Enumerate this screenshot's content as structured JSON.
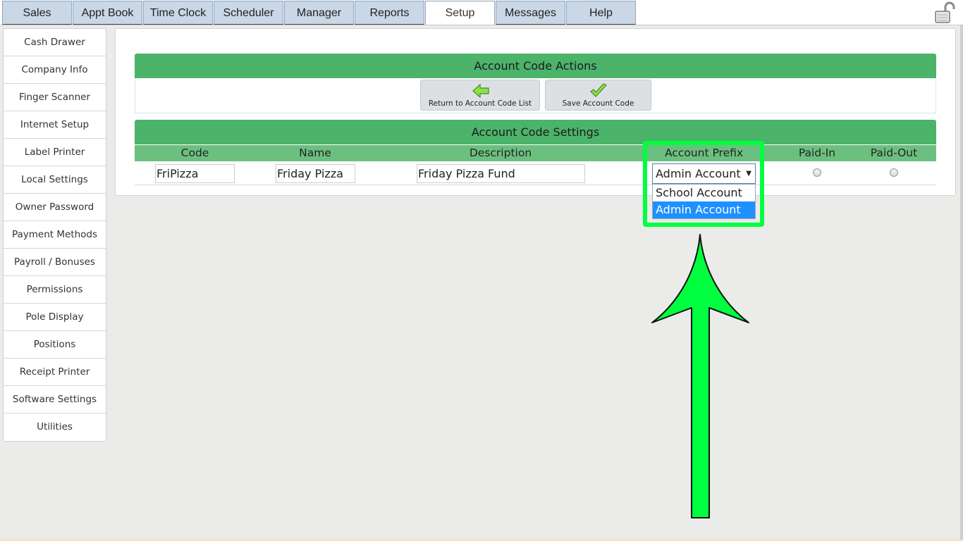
{
  "top_tabs": [
    {
      "label": "Sales"
    },
    {
      "label": "Appt Book"
    },
    {
      "label": "Time Clock"
    },
    {
      "label": "Scheduler"
    },
    {
      "label": "Manager"
    },
    {
      "label": "Reports"
    },
    {
      "label": "Setup",
      "active": true
    },
    {
      "label": "Messages"
    },
    {
      "label": "Help"
    }
  ],
  "lock_icon": "unlocked-padlock-icon",
  "sidebar": {
    "items": [
      {
        "label": "Cash Drawer"
      },
      {
        "label": "Company Info"
      },
      {
        "label": "Finger Scanner"
      },
      {
        "label": "Internet Setup"
      },
      {
        "label": "Label Printer"
      },
      {
        "label": "Local Settings"
      },
      {
        "label": "Owner Password"
      },
      {
        "label": "Payment Methods"
      },
      {
        "label": "Payroll / Bonuses"
      },
      {
        "label": "Permissions"
      },
      {
        "label": "Pole Display"
      },
      {
        "label": "Positions"
      },
      {
        "label": "Receipt Printer"
      },
      {
        "label": "Software Settings"
      },
      {
        "label": "Utilities"
      }
    ]
  },
  "actions": {
    "title": "Account Code Actions",
    "return_label": "Return to Account Code List",
    "return_icon": "back-arrow-icon",
    "save_label": "Save Account Code",
    "save_icon": "checkmark-icon"
  },
  "settings": {
    "title": "Account Code Settings",
    "columns": [
      "Code",
      "Name",
      "Description",
      "Account Prefix",
      "Paid-In",
      "Paid-Out"
    ],
    "row": {
      "code": "FriPizza",
      "name": "Friday Pizza",
      "description": "Friday Pizza Fund",
      "account_prefix": "Admin Account"
    },
    "prefix_options": [
      "School Account",
      "Admin Account"
    ],
    "prefix_selected_index": 1
  },
  "colors": {
    "header_green": "#4cb36a",
    "subheader_green": "#6cc07f",
    "highlight_green": "#00ff3e",
    "selected_blue": "#1e90ff",
    "tab_blue": "#c9d7e6"
  }
}
